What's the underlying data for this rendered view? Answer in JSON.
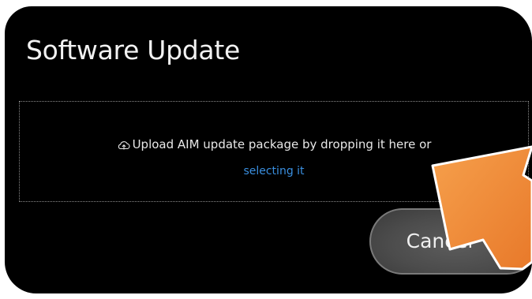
{
  "dialog": {
    "title": "Software Update",
    "background_color": "#000000"
  },
  "dropzone": {
    "icon": "cloud-upload-icon",
    "prompt_text": "Upload AIM update package by dropping it here or",
    "select_link_text": "selecting it",
    "link_color": "#3a8fe0"
  },
  "actions": {
    "cancel_label": "Cancel"
  },
  "annotation": {
    "icon": "pointer-arrow-icon",
    "color": "#f0883a"
  }
}
